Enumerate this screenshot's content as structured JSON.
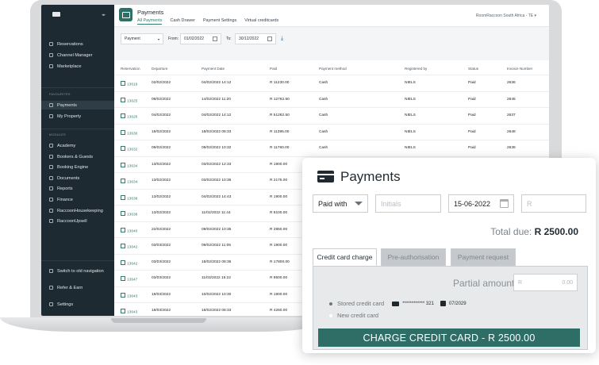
{
  "sidebar": {
    "items": [
      {
        "label": "Reservations"
      },
      {
        "label": "Channel Manager"
      },
      {
        "label": "Marketplace"
      }
    ],
    "favourites_header": "FAVOURITES",
    "favourites": [
      {
        "label": "Payments"
      },
      {
        "label": "My Property"
      }
    ],
    "modules_header": "MODULES",
    "modules": [
      {
        "label": "Academy"
      },
      {
        "label": "Bookers & Guests"
      },
      {
        "label": "Booking Engine"
      },
      {
        "label": "Documents"
      },
      {
        "label": "Reports"
      },
      {
        "label": "Finance"
      },
      {
        "label": "RaccoonHousekeeping"
      },
      {
        "label": "RaccoonUpsell"
      }
    ],
    "bottom": [
      {
        "label": "Switch to old navigation"
      },
      {
        "label": "Refer & Earn"
      },
      {
        "label": "Settings"
      }
    ]
  },
  "header": {
    "title": "Payments",
    "tabs": [
      "All Payments",
      "Cash Drawer",
      "Payment Settings",
      "Virtual creditcards"
    ],
    "account": "RoomRaccoon South Africa - TE"
  },
  "filters": {
    "type": "Payment",
    "from_label": "From:",
    "from": "01/02/2022",
    "to_label": "To:",
    "to": "30/12/2022"
  },
  "table": {
    "columns": [
      "Reservation",
      "Departure",
      "Payment Date",
      "Paid",
      "Payment method",
      "Registered by",
      "Status",
      "Invoice Number"
    ],
    "rows": [
      [
        "13619",
        "02/02/2022",
        "04/02/2022 14:12",
        "R 11230.00",
        "Cash",
        "NIELS",
        "Paid",
        "2636"
      ],
      [
        "13625",
        "08/02/2022",
        "14/02/2022 11:20",
        "R 12762.50",
        "Cash",
        "NIELS",
        "Paid",
        "2645"
      ],
      [
        "13626",
        "04/02/2022",
        "04/02/2022 14:12",
        "R 51282.50",
        "Cash",
        "NIELS",
        "Paid",
        "2637"
      ],
      [
        "13630",
        "16/02/2022",
        "18/02/2022 08:33",
        "R 11395.00",
        "Cash",
        "NIELS",
        "Paid",
        "2648"
      ],
      [
        "13632",
        "09/02/2022",
        "09/02/2022 10:32",
        "R 11760.00",
        "Cash",
        "NIELS",
        "Paid",
        "2638"
      ],
      [
        "13634",
        "13/02/2022",
        "03/02/2022 12:33",
        "R 1900.00",
        "",
        "",
        "",
        ""
      ],
      [
        "13634",
        "13/02/2022",
        "03/02/2022 10:36",
        "R 2175.00",
        "",
        "",
        "",
        ""
      ],
      [
        "13638",
        "13/02/2022",
        "04/02/2022 14:43",
        "R 1900.00",
        "",
        "",
        "",
        ""
      ],
      [
        "13638",
        "13/02/2022",
        "11/02/2022 11:44",
        "R 8100.00",
        "",
        "",
        "",
        ""
      ],
      [
        "13640",
        "22/02/2022",
        "09/02/2022 10:35",
        "R 2850.00",
        "",
        "",
        "",
        ""
      ],
      [
        "13642",
        "03/03/2022",
        "09/02/2022 11:05",
        "R 1900.00",
        "",
        "",
        "",
        ""
      ],
      [
        "13642",
        "03/03/2022",
        "18/02/2022 08:36",
        "R 17800.00",
        "",
        "",
        "",
        ""
      ],
      [
        "13647",
        "03/03/2022",
        "11/03/2022 15:22",
        "R 9500.00",
        "",
        "",
        "",
        ""
      ],
      [
        "13643",
        "18/03/2022",
        "10/02/2022 10:30",
        "R 1900.00",
        "",
        "",
        "",
        ""
      ],
      [
        "13643",
        "18/03/2022",
        "18/02/2022 08:33",
        "R 4260.00",
        "",
        "",
        "",
        ""
      ]
    ]
  },
  "card": {
    "title": "Payments",
    "paid_with": "Paid with",
    "initials_placeholder": "Initials",
    "date": "15-06-2022",
    "amount_placeholder": "R",
    "total_label": "Total due:",
    "total_value": "R 2500.00",
    "tabs": [
      "Credit card charge",
      "Pre-authorisation",
      "Payment request"
    ],
    "partial_label": "Partial amount:",
    "partial_prefix": "R",
    "partial_value": "0.00",
    "stored_label": "Stored credit card",
    "masked_number": "************ 321",
    "expiry": "07/2029",
    "new_label": "New credit card",
    "charge_button": "CHARGE CREDIT CARD - R 2500.00"
  },
  "colors": {
    "sidebar_bg": "#1e2a32",
    "accent": "#2f6e66",
    "link": "#2f7b6f"
  }
}
